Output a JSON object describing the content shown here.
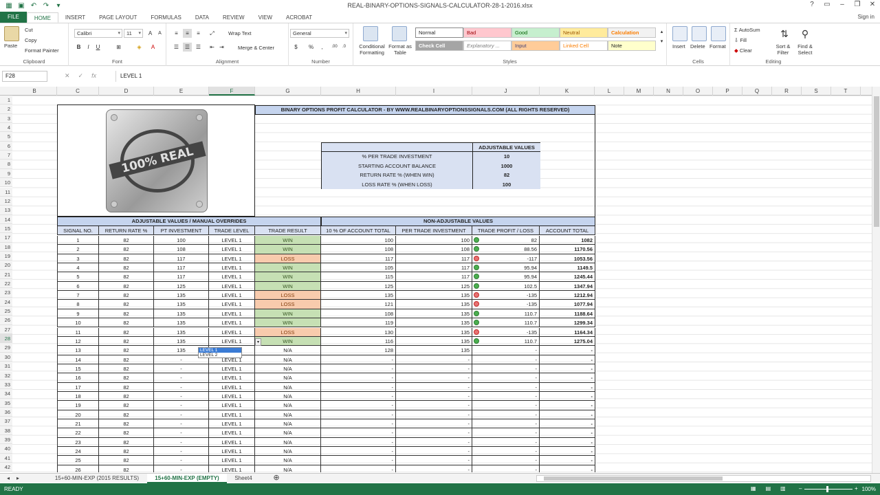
{
  "app": {
    "title": "REAL-BINARY-OPTIONS-SIGNALS-CALCULATOR-28-1-2016.xlsx",
    "signin": "Sign in",
    "accent": "#217346"
  },
  "tabs": [
    "FILE",
    "HOME",
    "INSERT",
    "PAGE LAYOUT",
    "FORMULAS",
    "DATA",
    "REVIEW",
    "VIEW",
    "ACROBAT"
  ],
  "ribbon": {
    "clipboard": {
      "paste": "Paste",
      "cut": "Cut",
      "copy": "Copy",
      "format_painter": "Format Painter",
      "label": "Clipboard"
    },
    "font": {
      "name": "Calibri",
      "size": "11",
      "label": "Font"
    },
    "alignment": {
      "wrap": "Wrap Text",
      "merge": "Merge & Center",
      "label": "Alignment"
    },
    "number": {
      "format": "General",
      "label": "Number"
    },
    "styles": {
      "conditional": "Conditional Formatting",
      "format_table": "Format as Table",
      "normal": "Normal",
      "bad": "Bad",
      "good": "Good",
      "neutral": "Neutral",
      "calculation": "Calculation",
      "check_cell": "Check Cell",
      "explanatory": "Explanatory ...",
      "input": "Input",
      "linked": "Linked Cell",
      "note": "Note",
      "label": "Styles"
    },
    "cells": {
      "insert": "Insert",
      "delete": "Delete",
      "format": "Format",
      "label": "Cells"
    },
    "editing": {
      "autosum": "AutoSum",
      "fill": "Fill",
      "clear": "Clear",
      "sort": "Sort & Filter",
      "find": "Find & Select",
      "label": "Editing"
    }
  },
  "formula_bar": {
    "name_box": "F28",
    "value": "LEVEL 1"
  },
  "columns": [
    "B",
    "C",
    "D",
    "E",
    "F",
    "G",
    "H",
    "I",
    "J",
    "K",
    "L",
    "M",
    "N",
    "O",
    "P",
    "Q",
    "R",
    "S",
    "T"
  ],
  "rows": [
    "1",
    "2",
    "3",
    "4",
    "5",
    "6",
    "7",
    "8",
    "9",
    "10",
    "11",
    "12",
    "13",
    "14",
    "15",
    "17",
    "18",
    "19",
    "20",
    "21",
    "22",
    "23",
    "24",
    "25",
    "26",
    "27",
    "28",
    "29",
    "30",
    "31",
    "32",
    "33",
    "34",
    "35",
    "36",
    "37",
    "38",
    "39",
    "40",
    "41",
    "42"
  ],
  "calc": {
    "title": "BINARY OPTIONS PROFIT CALCULATOR - BY WWW.REALBINARYOPTIONSSIGNALS.COM (ALL RIGHTS RESERVED)",
    "adjustable_header": "ADJUSTABLE VALUES",
    "params": [
      {
        "label": "% PER TRADE INVESTMENT",
        "value": "10"
      },
      {
        "label": "STARTING ACCOUNT BALANCE",
        "value": "1000"
      },
      {
        "label": "RETURN RATE % (WHEN WIN)",
        "value": "82"
      },
      {
        "label": "LOSS RATE % (WHEN LOSS)",
        "value": "100"
      }
    ],
    "logo_text": "100% REAL",
    "section_left": "ADJUSTABLE VALUES / MANUAL OVERRIDES",
    "section_right": "NON-ADJUSTABLE VALUES",
    "headers": [
      "SIGNAL NO.",
      "RETURN RATE %",
      "PT INVESTMENT",
      "TRADE LEVEL",
      "TRADE RESULT",
      "10 % OF ACCOUNT TOTAL",
      "PER TRADE INVESTMENT",
      "TRADE PROFIT / LOSS",
      "ACCOUNT TOTAL"
    ],
    "data": [
      [
        "1",
        "82",
        "100",
        "LEVEL 1",
        "WIN",
        "100",
        "100",
        "82",
        "1082"
      ],
      [
        "2",
        "82",
        "108",
        "LEVEL 1",
        "WIN",
        "108",
        "108",
        "88.56",
        "1170.56"
      ],
      [
        "3",
        "82",
        "117",
        "LEVEL 1",
        "LOSS",
        "117",
        "117",
        "-117",
        "1053.56"
      ],
      [
        "4",
        "82",
        "117",
        "LEVEL 1",
        "WIN",
        "105",
        "117",
        "95.94",
        "1149.5"
      ],
      [
        "5",
        "82",
        "117",
        "LEVEL 1",
        "WIN",
        "115",
        "117",
        "95.94",
        "1245.44"
      ],
      [
        "6",
        "82",
        "125",
        "LEVEL 1",
        "WIN",
        "125",
        "125",
        "102.5",
        "1347.94"
      ],
      [
        "7",
        "82",
        "135",
        "LEVEL 1",
        "LOSS",
        "135",
        "135",
        "-135",
        "1212.94"
      ],
      [
        "8",
        "82",
        "135",
        "LEVEL 1",
        "LOSS",
        "121",
        "135",
        "-135",
        "1077.94"
      ],
      [
        "9",
        "82",
        "135",
        "LEVEL 1",
        "WIN",
        "108",
        "135",
        "110.7",
        "1188.64"
      ],
      [
        "10",
        "82",
        "135",
        "LEVEL 1",
        "WIN",
        "119",
        "135",
        "110.7",
        "1299.34"
      ],
      [
        "11",
        "82",
        "135",
        "LEVEL 1",
        "LOSS",
        "130",
        "135",
        "-135",
        "1164.34"
      ],
      [
        "12",
        "82",
        "135",
        "LEVEL 1",
        "WIN",
        "116",
        "135",
        "110.7",
        "1275.04"
      ],
      [
        "13",
        "82",
        "135",
        "LEVEL 1",
        "N/A",
        "128",
        "135",
        "-",
        "-"
      ],
      [
        "14",
        "82",
        "-",
        "LEVEL 1",
        "N/A",
        "-",
        "-",
        "-",
        "-"
      ],
      [
        "15",
        "82",
        "-",
        "LEVEL 1",
        "N/A",
        "-",
        "-",
        "-",
        "-"
      ],
      [
        "16",
        "82",
        "-",
        "LEVEL 1",
        "N/A",
        "-",
        "-",
        "-",
        "-"
      ],
      [
        "17",
        "82",
        "-",
        "LEVEL 1",
        "N/A",
        "-",
        "-",
        "-",
        "-"
      ],
      [
        "18",
        "82",
        "-",
        "LEVEL 1",
        "N/A",
        "-",
        "-",
        "-",
        "-"
      ],
      [
        "19",
        "82",
        "-",
        "LEVEL 1",
        "N/A",
        "-",
        "-",
        "-",
        "-"
      ],
      [
        "20",
        "82",
        "-",
        "LEVEL 1",
        "N/A",
        "-",
        "-",
        "-",
        "-"
      ],
      [
        "21",
        "82",
        "-",
        "LEVEL 1",
        "N/A",
        "-",
        "-",
        "-",
        "-"
      ],
      [
        "22",
        "82",
        "-",
        "LEVEL 1",
        "N/A",
        "-",
        "-",
        "-",
        "-"
      ],
      [
        "23",
        "82",
        "-",
        "LEVEL 1",
        "N/A",
        "-",
        "-",
        "-",
        "-"
      ],
      [
        "24",
        "82",
        "-",
        "LEVEL 1",
        "N/A",
        "-",
        "-",
        "-",
        "-"
      ],
      [
        "25",
        "82",
        "-",
        "LEVEL 1",
        "N/A",
        "-",
        "-",
        "-",
        "-"
      ],
      [
        "26",
        "82",
        "-",
        "LEVEL 1",
        "N/A",
        "-",
        "-",
        "-",
        "-"
      ]
    ],
    "dropdown_options": [
      "LEVEL 1",
      "LEVEL 2"
    ]
  },
  "sheet_tabs": [
    "15+60-MIN-EXP (2015 RESULTS)",
    "15+60-MIN-EXP (EMPTY)",
    "Sheet4"
  ],
  "status": {
    "ready": "READY",
    "zoom": "100%"
  },
  "colors": {
    "win": "#c6e0b4",
    "loss": "#f8cbad",
    "header_blue": "#c5d4ee"
  }
}
